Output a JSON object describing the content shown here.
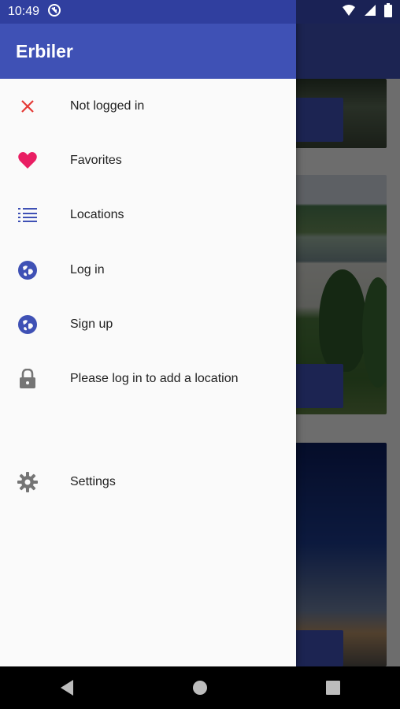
{
  "status_bar": {
    "time": "10:49",
    "icons": [
      "sync-icon",
      "wifi-icon",
      "signal-icon",
      "battery-icon"
    ]
  },
  "drawer": {
    "title": "Erbiler",
    "items": [
      {
        "label": "Not logged in",
        "icon": "close-icon",
        "color": "#e53935"
      },
      {
        "label": "Favorites",
        "icon": "heart-icon",
        "color": "#e91e63"
      },
      {
        "label": "Locations",
        "icon": "list-icon",
        "color": "#3f51b5"
      },
      {
        "label": "Log in",
        "icon": "globe-icon",
        "color": "#3f51b5"
      },
      {
        "label": "Sign up",
        "icon": "globe-icon",
        "color": "#3f51b5"
      },
      {
        "label": "Please log in to add a location",
        "icon": "lock-icon",
        "color": "#757575"
      },
      {
        "label": "Settings",
        "icon": "gear-icon",
        "color": "#757575"
      }
    ]
  },
  "colors": {
    "primary": "#3f51b5",
    "primary_dark": "#303f9f"
  },
  "nav_bar": {
    "buttons": [
      "back-button",
      "home-button",
      "recents-button"
    ]
  }
}
